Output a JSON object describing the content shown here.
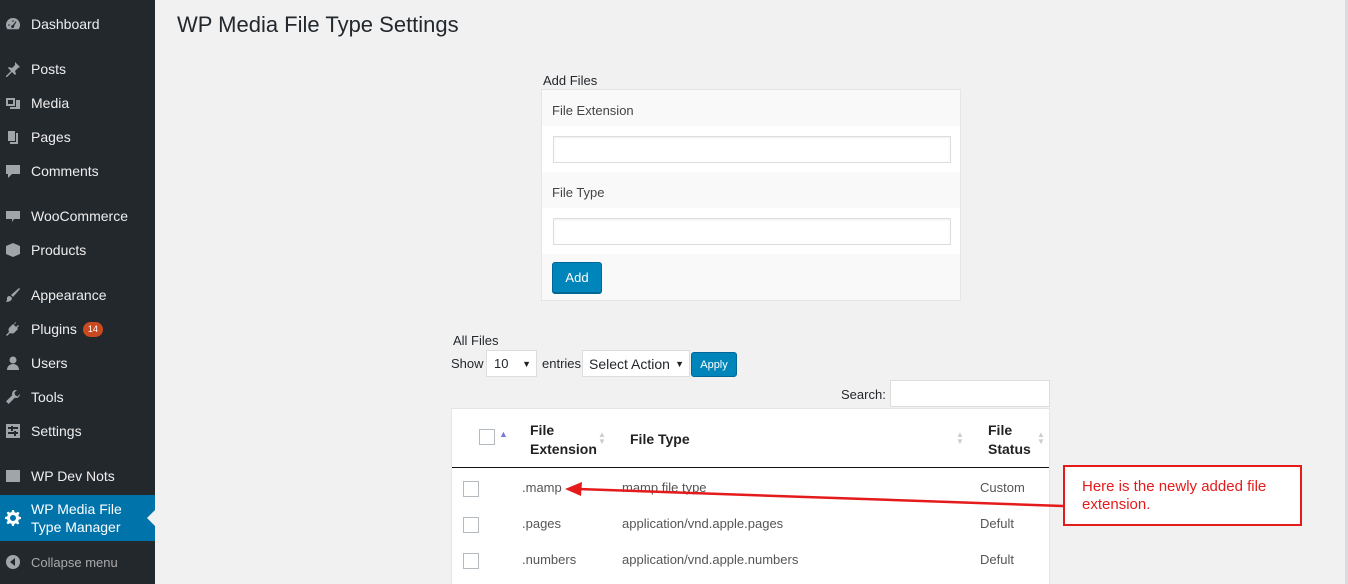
{
  "sidebar": {
    "items": [
      {
        "label": "Dashboard",
        "icon": "dashboard-icon"
      },
      {
        "label": "Posts",
        "icon": "pin-icon"
      },
      {
        "label": "Media",
        "icon": "media-icon"
      },
      {
        "label": "Pages",
        "icon": "pages-icon"
      },
      {
        "label": "Comments",
        "icon": "comment-icon"
      },
      {
        "label": "WooCommerce",
        "icon": "woo-icon"
      },
      {
        "label": "Products",
        "icon": "box-icon"
      },
      {
        "label": "Appearance",
        "icon": "brush-icon"
      },
      {
        "label": "Plugins",
        "icon": "plugin-icon",
        "badge": "14"
      },
      {
        "label": "Users",
        "icon": "user-icon"
      },
      {
        "label": "Tools",
        "icon": "wrench-icon"
      },
      {
        "label": "Settings",
        "icon": "settings-icon"
      },
      {
        "label": "WP Dev Nots",
        "icon": "list-icon"
      },
      {
        "label": "WP Media File Type Manager",
        "icon": "gear-icon",
        "active": true
      }
    ],
    "collapse_label": "Collapse menu"
  },
  "page_title": "WP Media File Type Settings",
  "add_files": {
    "heading": "Add Files",
    "extension_label": "File Extension",
    "extension_value": "",
    "type_label": "File Type",
    "type_value": "",
    "add_button": "Add"
  },
  "all_files": {
    "heading": "All Files",
    "show_label": "Show",
    "show_value": "10",
    "entries_label": "entries",
    "action_value": "Select Action",
    "apply_button": "Apply",
    "search_label": "Search:",
    "search_value": "",
    "columns": {
      "extension_line1": "File",
      "extension_line2": "Extension",
      "type": "File Type",
      "status_line1": "File",
      "status_line2": "Status"
    },
    "rows": [
      {
        "extension": ".mamp",
        "type": "mamp file type",
        "status": "Custom"
      },
      {
        "extension": ".pages",
        "type": "application/vnd.apple.pages",
        "status": "Defult"
      },
      {
        "extension": ".numbers",
        "type": "application/vnd.apple.numbers",
        "status": "Defult"
      }
    ]
  },
  "annotation": {
    "text": "Here is the newly added file extension.",
    "color": "#e51b1b"
  },
  "colors": {
    "sidebar_bg": "#23282d",
    "active_bg": "#0073aa",
    "button_bg": "#0085ba",
    "page_bg": "#f1f1f1"
  }
}
